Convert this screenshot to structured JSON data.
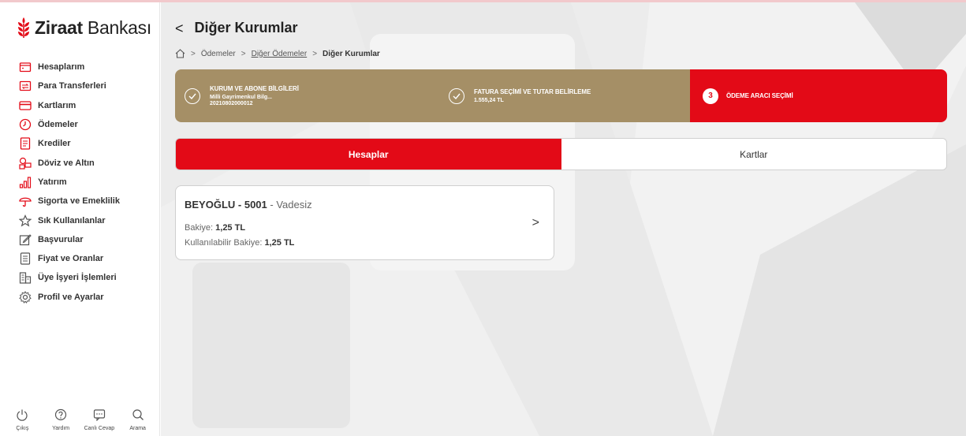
{
  "brand": {
    "name_bold": "Ziraat",
    "name_rest": " Bankası",
    "color": "#e30a17"
  },
  "sidebar": {
    "items": [
      {
        "label": "Hesaplarım",
        "icon": "folder-icon"
      },
      {
        "label": "Para Transferleri",
        "icon": "transfer-icon"
      },
      {
        "label": "Kartlarım",
        "icon": "card-icon"
      },
      {
        "label": "Ödemeler",
        "icon": "clock-icon"
      },
      {
        "label": "Krediler",
        "icon": "document-icon"
      },
      {
        "label": "Döviz ve Altın",
        "icon": "exchange-icon"
      },
      {
        "label": "Yatırım",
        "icon": "bar-chart-icon"
      },
      {
        "label": "Sigorta ve Emeklilik",
        "icon": "umbrella-icon"
      },
      {
        "label": "Sık Kullanılanlar",
        "icon": "star-icon"
      },
      {
        "label": "Başvurular",
        "icon": "edit-icon"
      },
      {
        "label": "Fiyat ve Oranlar",
        "icon": "list-icon"
      },
      {
        "label": "Üye İşyeri İşlemleri",
        "icon": "building-icon"
      },
      {
        "label": "Profil ve Ayarlar",
        "icon": "gear-icon"
      }
    ],
    "tools": [
      {
        "label": "Çıkış",
        "icon": "power-icon"
      },
      {
        "label": "Yardım",
        "icon": "help-icon"
      },
      {
        "label": "Canlı Cevap",
        "icon": "chat-icon"
      },
      {
        "label": "Arama",
        "icon": "search-icon"
      }
    ]
  },
  "header": {
    "back": "<",
    "title": "Diğer Kurumlar"
  },
  "breadcrumb": {
    "items": [
      "Ödemeler",
      "Diğer Ödemeler",
      "Diğer Kurumlar"
    ],
    "separator": ">"
  },
  "stepper": {
    "steps": [
      {
        "title": "KURUM VE ABONE BİLGİLERİ",
        "sub1": "Milli Gayrimenkul Bilg...",
        "sub2": "20210802000012",
        "status": "done"
      },
      {
        "title": "FATURA SEÇİMİ VE TUTAR BELİRLEME",
        "sub1": "1.555,24 TL",
        "status": "done"
      },
      {
        "number": "3",
        "title": "ÖDEME ARACI SEÇİMİ",
        "status": "active"
      }
    ],
    "done_color": "#a58f66",
    "active_color": "#e30a17"
  },
  "tabs": [
    {
      "label": "Hesaplar",
      "active": true
    },
    {
      "label": "Kartlar",
      "active": false
    }
  ],
  "account": {
    "branch": "BEYOĞLU - 5001",
    "type": " - Vadesiz",
    "balance_label": "Bakiye: ",
    "balance_value": "1,25 TL",
    "available_label": "Kullanılabilir Bakiye: ",
    "available_value": "1,25 TL",
    "chevron": ">"
  }
}
